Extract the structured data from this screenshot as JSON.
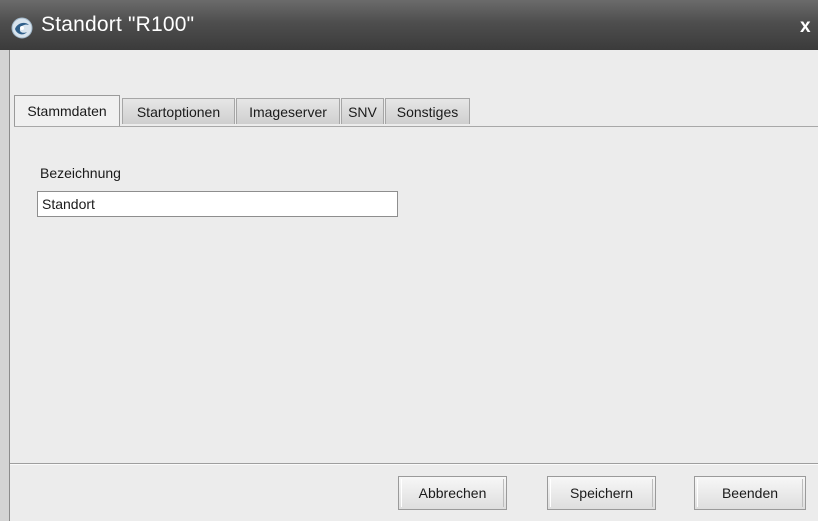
{
  "window": {
    "title": "Standort \"R100\"",
    "close_label": "x"
  },
  "tabs": [
    {
      "label": "Stammdaten",
      "active": true
    },
    {
      "label": "Startoptionen",
      "active": false
    },
    {
      "label": "Imageserver",
      "active": false
    },
    {
      "label": "SNV",
      "active": false
    },
    {
      "label": "Sonstiges",
      "active": false
    }
  ],
  "form": {
    "bezeichnung_label": "Bezeichnung",
    "bezeichnung_value": "Standort"
  },
  "buttons": {
    "cancel": "Abbrechen",
    "save": "Speichern",
    "exit": "Beenden"
  },
  "icons": {
    "title_icon": "app-logo-icon"
  }
}
